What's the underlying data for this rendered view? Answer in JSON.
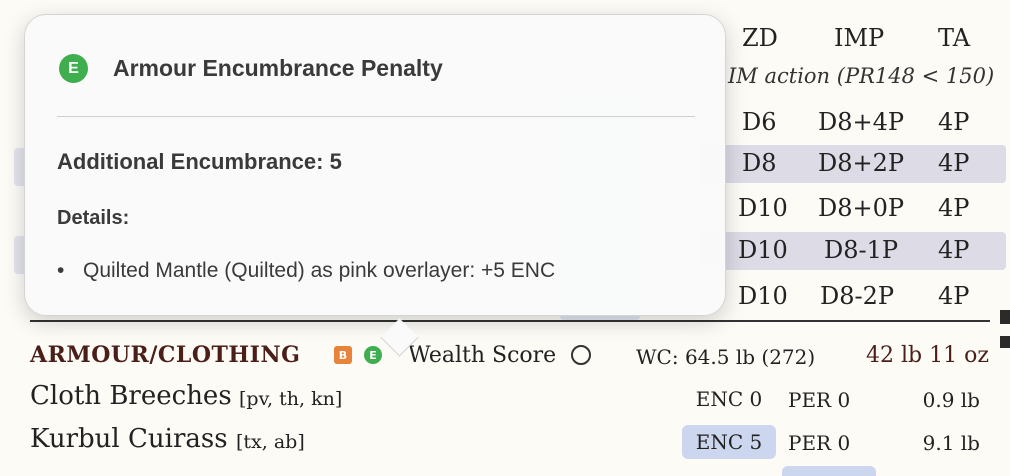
{
  "weapon_table": {
    "headers": {
      "zd": "ZD",
      "imp": "IMP",
      "ta": "TA"
    },
    "note": "IM action (PR148 < 150)",
    "rows": [
      {
        "zd": "D6",
        "imp": "D8+4P",
        "ta": "4P"
      },
      {
        "zd": "D8",
        "imp": "D8+2P",
        "ta": "4P"
      },
      {
        "zd": "D10",
        "imp": "D8+0P",
        "ta": "4P"
      },
      {
        "zd": "D10",
        "imp": "D8-1P",
        "ta": "4P"
      },
      {
        "zd": "D10",
        "imp": "D8-2P",
        "ta": "4P"
      }
    ]
  },
  "armour": {
    "title": "ARMOUR/CLOTHING",
    "badge_b": "B",
    "badge_e": "E",
    "wealth_label": "Wealth Score",
    "wc": "WC: 64.5 lb (272)",
    "total_weight": "42 lb 11 oz",
    "items": [
      {
        "name": "Cloth Breeches",
        "tags": "[pv, th, kn]",
        "enc": "ENC 0",
        "per": "PER 0",
        "weight": "0.9 lb"
      },
      {
        "name": "Kurbul Cuirass",
        "tags": "[tx, ab]",
        "enc": "ENC 5",
        "per": "PER 0",
        "weight": "9.1 lb"
      }
    ]
  },
  "tooltip": {
    "badge": "E",
    "title": "Armour Encumbrance Penalty",
    "additional": "Additional Encumbrance: 5",
    "details_label": "Details:",
    "details": [
      "Quilted Mantle (Quilted) as pink overlayer: +5 ENC"
    ],
    "bullet_glyph": "•"
  },
  "colors": {
    "accent_green": "#3fae4f",
    "accent_orange": "#e8833a",
    "heading_brown": "#4a1f1a",
    "highlight_blue": "#cdd6ef",
    "row_shade": "#dcdbe6"
  }
}
